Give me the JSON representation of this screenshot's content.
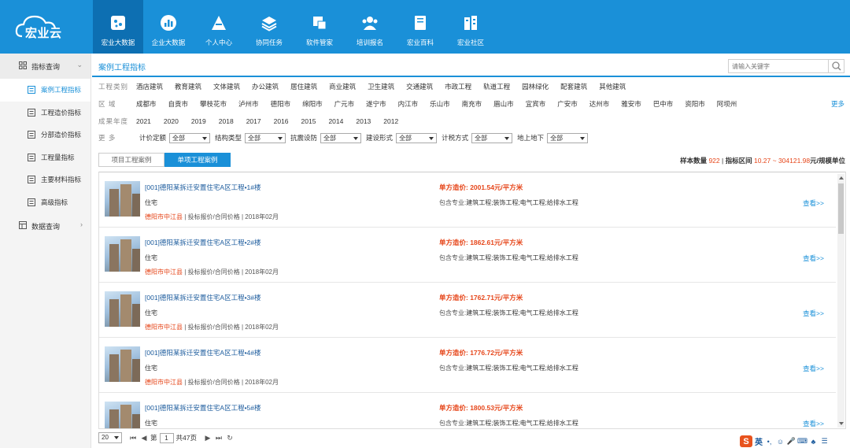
{
  "logo": {
    "text": "宏业云"
  },
  "nav": [
    {
      "label": "宏业大数据",
      "icon": "data-cube-icon",
      "active": true
    },
    {
      "label": "企业大数据",
      "icon": "bar-chart-icon"
    },
    {
      "label": "个人中心",
      "icon": "user-road-icon"
    },
    {
      "label": "协同任务",
      "icon": "layers-icon"
    },
    {
      "label": "软件管家",
      "icon": "software-icon"
    },
    {
      "label": "培训报名",
      "icon": "people-icon"
    },
    {
      "label": "宏业百科",
      "icon": "book-icon"
    },
    {
      "label": "宏业社区",
      "icon": "building-icon"
    }
  ],
  "sidebar": {
    "group1": "指标查询",
    "items": [
      "案例工程指标",
      "工程造价指标",
      "分部造价指标",
      "工程量指标",
      "主要材料指标",
      "高级指标"
    ],
    "group2": "数据查询"
  },
  "main": {
    "title": "案例工程指标",
    "search_placeholder": "请输入关键字"
  },
  "filters": {
    "type_label": "工程类别",
    "types": [
      "酒店建筑",
      "教育建筑",
      "文体建筑",
      "办公建筑",
      "居住建筑",
      "商业建筑",
      "卫生建筑",
      "交通建筑",
      "市政工程",
      "轨道工程",
      "园林绿化",
      "配套建筑",
      "其他建筑"
    ],
    "region_label": "区 域",
    "regions": [
      "成都市",
      "自贡市",
      "攀枝花市",
      "泸州市",
      "德阳市",
      "绵阳市",
      "广元市",
      "遂宁市",
      "内江市",
      "乐山市",
      "南充市",
      "眉山市",
      "宜宾市",
      "广安市",
      "达州市",
      "雅安市",
      "巴中市",
      "资阳市",
      "阿坝州"
    ],
    "more": "更多",
    "year_label": "成果年度",
    "years": [
      "2021",
      "2020",
      "2019",
      "2018",
      "2017",
      "2016",
      "2015",
      "2014",
      "2013",
      "2012"
    ],
    "more_label": "更 多",
    "selects": [
      {
        "label": "计价定额",
        "value": "全部"
      },
      {
        "label": "结构类型",
        "value": "全部"
      },
      {
        "label": "抗震设防",
        "value": "全部"
      },
      {
        "label": "建设形式",
        "value": "全部"
      },
      {
        "label": "计税方式",
        "value": "全部"
      },
      {
        "label": "地上地下",
        "value": "全部"
      }
    ]
  },
  "tabs": [
    "项目工程案例",
    "单项工程案例"
  ],
  "stats": {
    "count_label": "样本数量",
    "count": "922",
    "range_label": "指标区间",
    "range": "10.27 ~ 304121.98",
    "unit": "元/规模单位"
  },
  "cases": [
    {
      "title": "[001]德阳某拆迁安置住宅A区工程•1#楼",
      "type": "住宅",
      "location": "德阳市中江县",
      "meta": "投标报价/合同价格 | 2018年02月",
      "price": "单方造价: 2001.54元/平方米",
      "spec_label": "包含专业:",
      "spec": "建筑工程;装饰工程;电气工程;给排水工程",
      "view": "查看>>"
    },
    {
      "title": "[001]德阳某拆迁安置住宅A区工程•2#楼",
      "type": "住宅",
      "location": "德阳市中江县",
      "meta": "投标报价/合同价格 | 2018年02月",
      "price": "单方造价: 1862.61元/平方米",
      "spec_label": "包含专业:",
      "spec": "建筑工程;装饰工程;电气工程;给排水工程",
      "view": "查看>>"
    },
    {
      "title": "[001]德阳某拆迁安置住宅A区工程•3#楼",
      "type": "住宅",
      "location": "德阳市中江县",
      "meta": "投标报价/合同价格 | 2018年02月",
      "price": "单方造价: 1762.71元/平方米",
      "spec_label": "包含专业:",
      "spec": "建筑工程;装饰工程;电气工程;给排水工程",
      "view": "查看>>"
    },
    {
      "title": "[001]德阳某拆迁安置住宅A区工程•4#楼",
      "type": "住宅",
      "location": "德阳市中江县",
      "meta": "投标报价/合同价格 | 2018年02月",
      "price": "单方造价: 1776.72元/平方米",
      "spec_label": "包含专业:",
      "spec": "建筑工程;装饰工程;电气工程;给排水工程",
      "view": "查看>>"
    },
    {
      "title": "[001]德阳某拆迁安置住宅A区工程•5#楼",
      "type": "住宅",
      "location": "",
      "meta": "",
      "price": "单方造价: 1800.53元/平方米",
      "spec_label": "包含专业:",
      "spec": "建筑工程;装饰工程;电气工程;给排水工程",
      "view": "查看>>"
    }
  ],
  "pager": {
    "size": "20",
    "page_prefix": "第",
    "page": "1",
    "total": "共47页"
  },
  "ime": {
    "logo": "S",
    "mode": "英"
  }
}
